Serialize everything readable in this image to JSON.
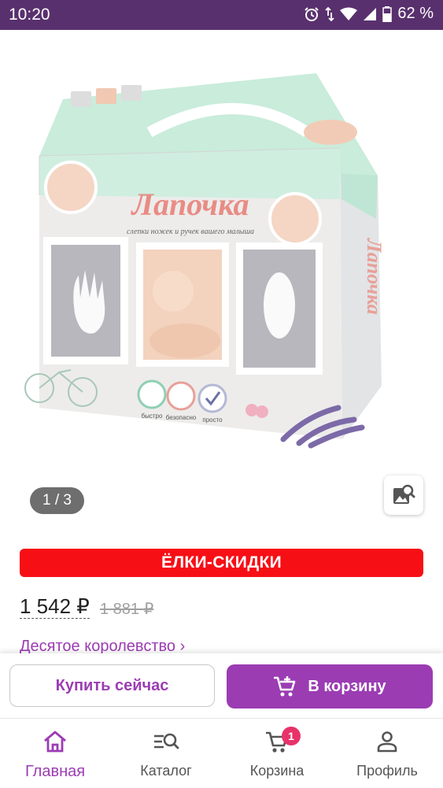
{
  "status_bar": {
    "time": "10:20",
    "battery_percent": "62 %",
    "icons": [
      "alarm-icon",
      "data-arrows-icon",
      "wifi-icon",
      "signal-icon",
      "battery-icon"
    ]
  },
  "gallery": {
    "counter": "1 / 3",
    "image_icon": "image-search-icon",
    "image": {
      "box_title": "Лапочка",
      "box_subtitle": "слепки ножек и ручек вашего малыша",
      "side_title": "Лапочка",
      "features": [
        "быстро",
        "безопасно",
        "просто"
      ]
    }
  },
  "product": {
    "sale_badge": "ЁЛКИ-СКИДКИ",
    "price": "1 542 ₽",
    "old_price": "1 881 ₽",
    "brand_link": "Десятое королевство ›"
  },
  "actions": {
    "buy_now": "Купить сейчас",
    "add_to_cart": "В корзину"
  },
  "bottom_nav": {
    "items": [
      {
        "label": "Главная",
        "icon": "home-icon",
        "active": true
      },
      {
        "label": "Каталог",
        "icon": "catalog-search-icon",
        "active": false
      },
      {
        "label": "Корзина",
        "icon": "cart-icon",
        "active": false
      },
      {
        "label": "Профиль",
        "icon": "profile-icon",
        "active": false
      }
    ],
    "cart_badge": "1"
  },
  "colors": {
    "status_bar": "#59306e",
    "accent": "#9b3cb3",
    "sale": "#f70f16",
    "badge": "#e8326a"
  }
}
